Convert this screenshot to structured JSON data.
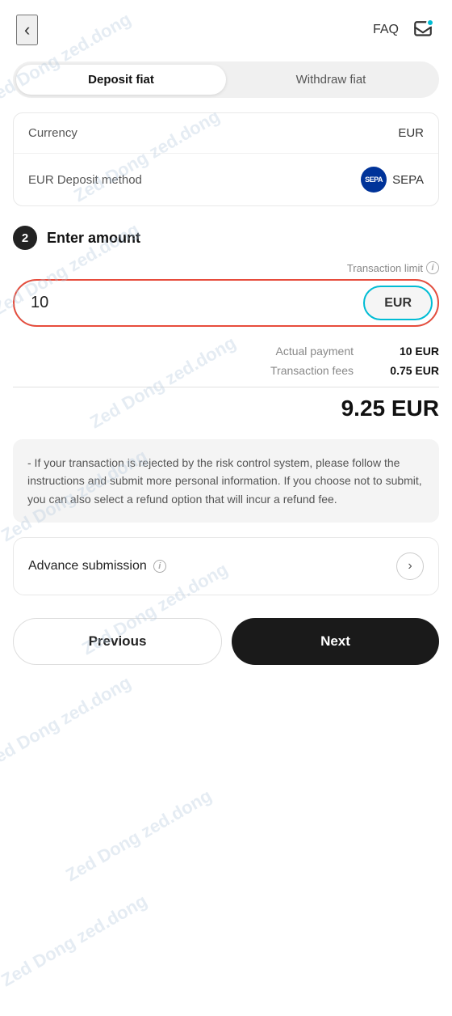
{
  "header": {
    "back_label": "‹",
    "faq_label": "FAQ"
  },
  "tabs": {
    "items": [
      {
        "id": "deposit",
        "label": "Deposit fiat",
        "active": true
      },
      {
        "id": "withdraw",
        "label": "Withdraw fiat",
        "active": false
      }
    ]
  },
  "info_rows": [
    {
      "label": "Currency",
      "value": "EUR",
      "has_badge": false
    },
    {
      "label": "EUR Deposit method",
      "value": "SEPA",
      "has_badge": true
    }
  ],
  "step": {
    "number": "2",
    "title": "Enter amount"
  },
  "amount_input": {
    "value": "10",
    "placeholder": "0",
    "currency": "EUR",
    "transaction_limit_label": "Transaction limit",
    "info_symbol": "i"
  },
  "summary": {
    "actual_payment_label": "Actual payment",
    "actual_payment_value": "10 EUR",
    "transaction_fees_label": "Transaction fees",
    "transaction_fees_value": "0.75 EUR",
    "total": "9.25 EUR"
  },
  "info_box": {
    "text": "- If your transaction is rejected by the risk control system, please follow the instructions and submit more personal information. If you choose not to submit, you can also select a refund option that will incur a refund fee."
  },
  "advance_submission": {
    "label": "Advance submission",
    "info_symbol": "i"
  },
  "buttons": {
    "previous": "Previous",
    "next": "Next"
  },
  "watermark": "Zed Dong zed.dong"
}
